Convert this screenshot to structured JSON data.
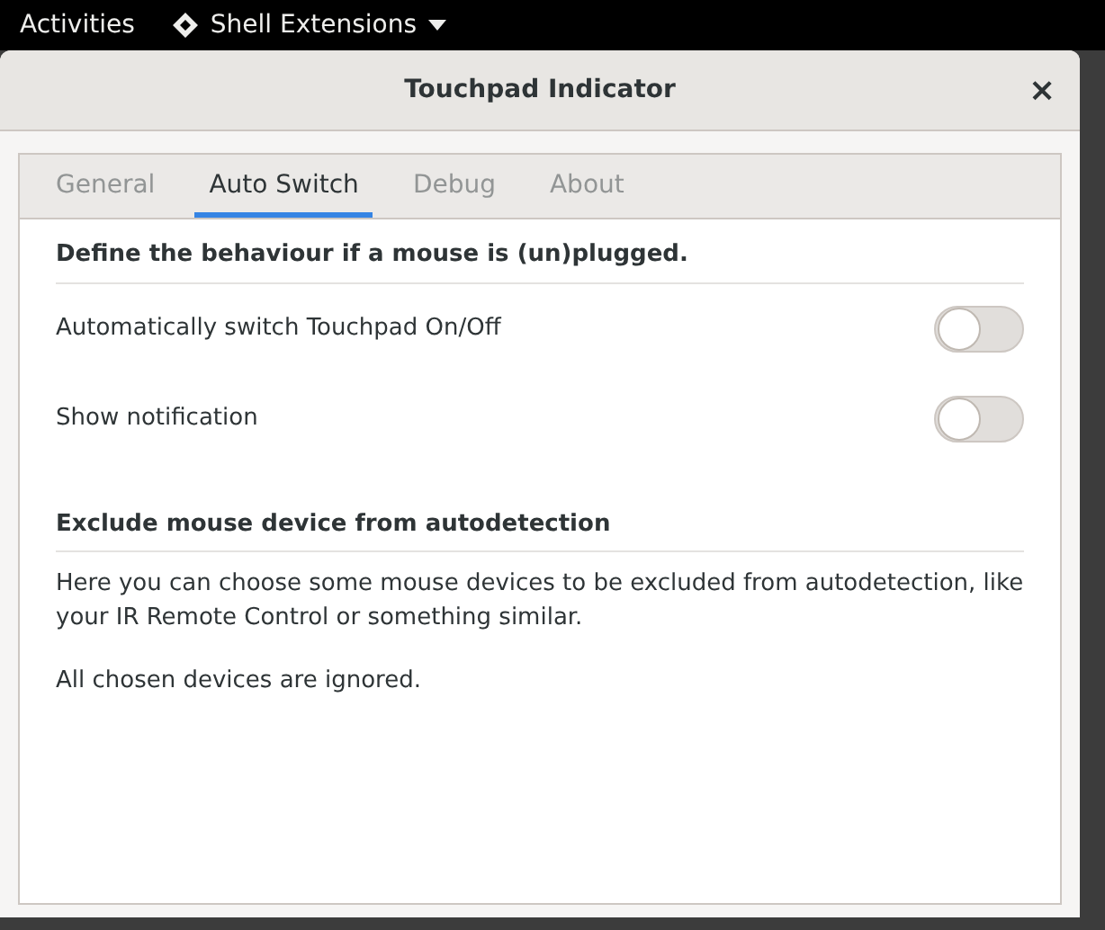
{
  "top_bar": {
    "activities": "Activities",
    "app_menu": "Shell Extensions"
  },
  "window": {
    "title": "Touchpad Indicator",
    "close": "×"
  },
  "tabs": [
    {
      "label": "General",
      "selected": false
    },
    {
      "label": "Auto Switch",
      "selected": true
    },
    {
      "label": "Debug",
      "selected": false
    },
    {
      "label": "About",
      "selected": false
    }
  ],
  "sections": [
    {
      "heading": "Define the behaviour if a mouse is (un)plugged.",
      "switches": [
        {
          "label": "Automatically switch Touchpad On/Off",
          "on": false
        },
        {
          "label": "Show notification",
          "on": false
        }
      ]
    },
    {
      "heading": "Exclude mouse device from autodetection",
      "paragraphs": [
        "Here you can choose some mouse devices to be excluded from autodetection, like your IR Remote Control or something similar.",
        "All chosen devices are ignored."
      ]
    }
  ]
}
